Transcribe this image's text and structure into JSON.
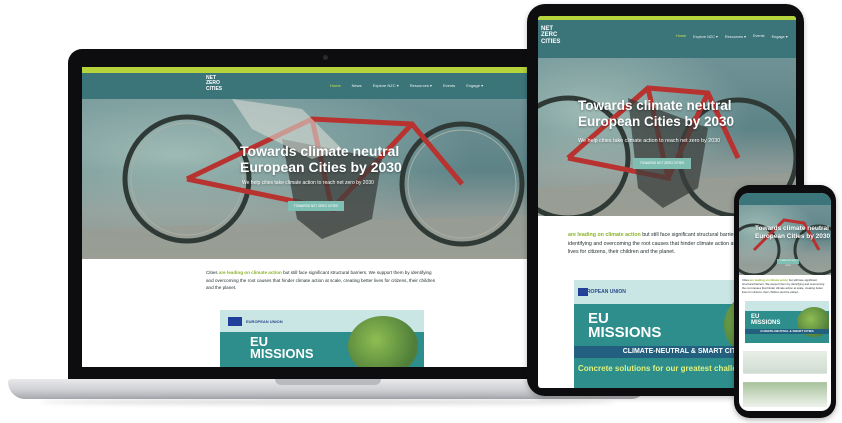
{
  "site": {
    "logo_lines": [
      "NET",
      "ZERO",
      "CITIES"
    ],
    "logo_lines_tablet": [
      "NET",
      "ZERC",
      "CITIES"
    ],
    "nav": [
      "Home",
      "News",
      "Explore NZC",
      "Resources",
      "Events",
      "Engage"
    ],
    "nav_with_arrows": [
      "Home",
      "News",
      "Explore NZC ▾",
      "Resources ▾",
      "Events",
      "Engage ▾"
    ],
    "hero_title_line1": "Towards climate neutral",
    "hero_title_line2": "European Cities by 2030",
    "hero_subtitle": "We help cities take climate action to reach net zero by 2030",
    "hero_button": "TOWARDS NET ZERO CITIES",
    "intro_prefix": "Cities ",
    "intro_highlight": "are leading on climate action",
    "intro_rest": " but still face significant structural barriers. We support them by identifying and overcoming the root causes that hinder climate action at scale, creating better lives for citizens, their children and the planet.",
    "tablet_intro_rest": " but still face significant structural barriers. We support them by identifying and overcoming the root causes that hinder climate action at scale, creating better lives for citizens, their children and the planet.",
    "banner_eu": "EUROPEAN UNION",
    "banner_eu_title": "EU",
    "banner_missions": "MISSIONS",
    "banner_strip": "CLIMATE-NEUTRAL & SMART CITIES",
    "banner_tagline": "Concrete solutions for our greatest challenges"
  },
  "colors": {
    "teal_nav": "#3c7579",
    "lime": "#b5d33a",
    "banner_teal": "#2e8e8b",
    "banner_strip": "#235f7e"
  }
}
